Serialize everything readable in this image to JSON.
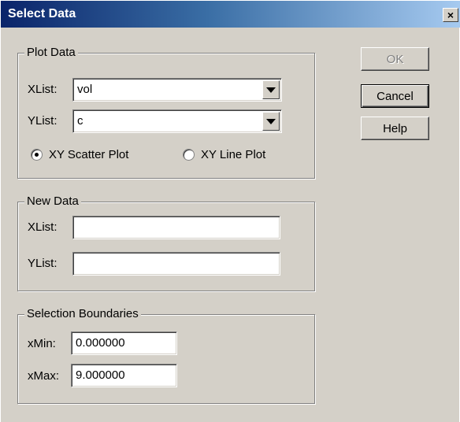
{
  "window": {
    "title": "Select Data",
    "close_glyph": "×"
  },
  "plot_data": {
    "legend": "Plot Data",
    "xlist_label": "XList:",
    "xlist_value": "vol",
    "ylist_label": "YList:",
    "ylist_value": "c",
    "scatter_label": "XY Scatter Plot",
    "line_label": "XY Line Plot",
    "selected_plot": "XY Scatter Plot"
  },
  "new_data": {
    "legend": "New Data",
    "xlist_label": "XList:",
    "xlist_value": "",
    "ylist_label": "YList:",
    "ylist_value": ""
  },
  "selection_boundaries": {
    "legend": "Selection Boundaries",
    "xmin_label": "xMin:",
    "xmin_value": "0.000000",
    "xmax_label": "xMax:",
    "xmax_value": "9.000000"
  },
  "buttons": {
    "ok_label": "OK",
    "cancel_label": "Cancel",
    "help_label": "Help"
  }
}
